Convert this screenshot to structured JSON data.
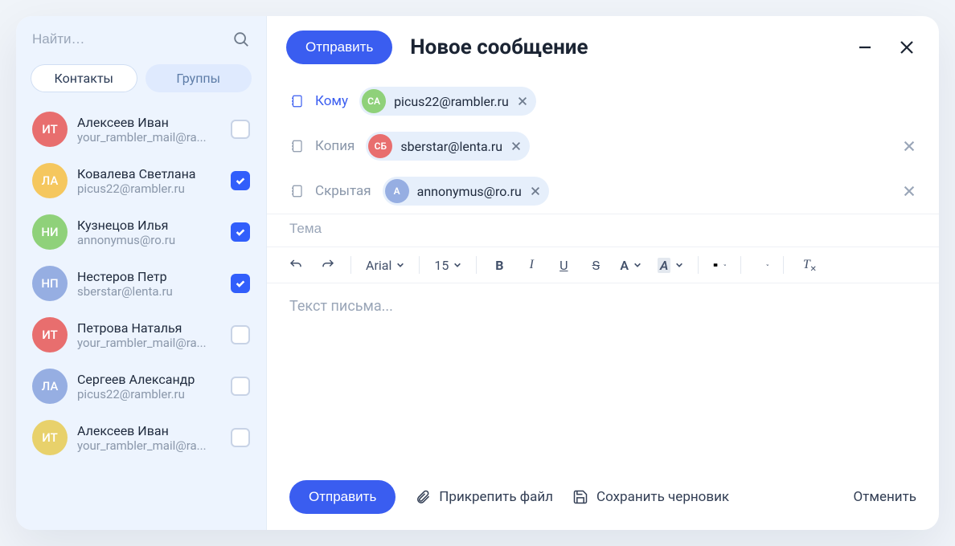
{
  "sidebar": {
    "search_placeholder": "Найти…",
    "tabs": {
      "contacts": "Контакты",
      "groups": "Группы"
    },
    "contacts": [
      {
        "initials": "ИТ",
        "color": "#e86e6e",
        "name": "Алексеев Иван",
        "email": "your_rambler_mail@ra...",
        "checked": false
      },
      {
        "initials": "ЛА",
        "color": "#f5c75e",
        "name": "Ковалева Светлана",
        "email": "picus22@rambler.ru",
        "checked": true
      },
      {
        "initials": "НИ",
        "color": "#8fd17a",
        "name": "Кузнецов Илья",
        "email": "annonymus@ro.ru",
        "checked": true
      },
      {
        "initials": "НП",
        "color": "#96aee2",
        "name": "Нестеров Петр",
        "email": "sberstar@lenta.ru",
        "checked": true
      },
      {
        "initials": "ИТ",
        "color": "#e86e6e",
        "name": "Петрова Наталья",
        "email": "your_rambler_mail@ra...",
        "checked": false
      },
      {
        "initials": "ЛА",
        "color": "#96aee2",
        "name": "Сергеев Александр",
        "email": "picus22@rambler.ru",
        "checked": false
      },
      {
        "initials": "ИТ",
        "color": "#e8d16b",
        "name": "Алексеев Иван",
        "email": "your_rambler_mail@ra...",
        "checked": false
      }
    ]
  },
  "compose": {
    "send_label": "Отправить",
    "title": "Новое сообщение",
    "to_label": "Кому",
    "cc_label": "Копия",
    "bcc_label": "Скрытая",
    "to_chip": {
      "initials": "СА",
      "color": "#8fd17a",
      "email": "picus22@rambler.ru"
    },
    "cc_chip": {
      "initials": "СБ",
      "color": "#e86e6e",
      "email": "sberstar@lenta.ru"
    },
    "bcc_chip": {
      "initials": "А",
      "color": "#96aee2",
      "email": "annonymus@ro.ru"
    },
    "subject_placeholder": "Тема",
    "body_placeholder": "Текст письма...",
    "toolbar": {
      "font": "Arial",
      "size": "15"
    },
    "footer": {
      "send": "Отправить",
      "attach": "Прикрепить файл",
      "save_draft": "Сохранить черновик",
      "cancel": "Отменить"
    }
  }
}
